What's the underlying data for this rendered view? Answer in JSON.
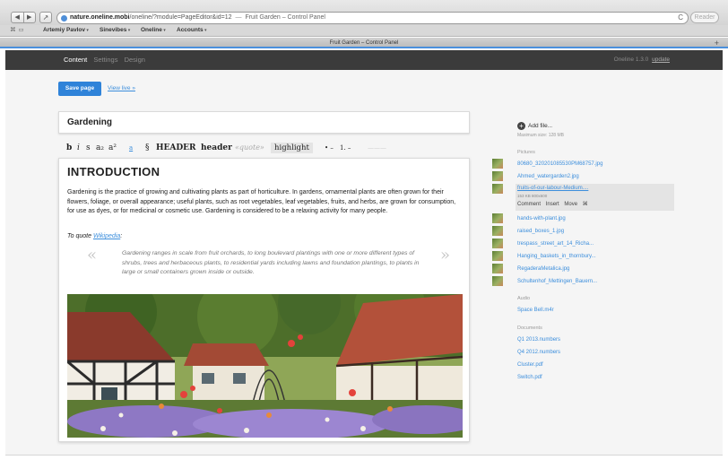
{
  "browser": {
    "nav_back": "◀",
    "nav_forward": "▶",
    "share": "↗",
    "url_host": "nature.oneline.mobi",
    "url_path": "/oneline/?module=PageEditor&id=12",
    "url_separator": "—",
    "url_page_title": "Fruit Garden – Control Panel",
    "reload": "C",
    "reader": "Reader",
    "bookmark_icons": "⌘▭",
    "bookmarks": [
      "Artemiy Pavlov",
      "Sinevibes",
      "Oneline",
      "Accounts"
    ],
    "tab_title": "Fruit Garden – Control Panel",
    "new_tab": "+"
  },
  "app": {
    "nav": {
      "content": "Content",
      "settings": "Settings",
      "design": "Design"
    },
    "version": "Oneline 1.3.0",
    "update": "update",
    "save_label": "Save page",
    "view_live": "View live »",
    "page_title": "Gardening"
  },
  "format_bar": {
    "bold": "b",
    "italic": "i",
    "strike": "s",
    "subscript": "a₂",
    "superscript": "a²",
    "link": "a",
    "section": "§",
    "header_big": "HEADER",
    "header_small": "header",
    "quote": "«quote»",
    "highlight": "highlight",
    "bullet_list": "• –",
    "numbered_list": "1. –",
    "divider": "———"
  },
  "editor": {
    "heading": "INTRODUCTION",
    "paragraph": "Gardening is the practice of growing and cultivating plants as part of horticulture. In gardens, ornamental plants are often grown for their flowers, foliage, or overall appearance; useful plants, such as root vegetables, leaf vegetables, fruits, and herbs, are grown for consumption, for use as dyes, or for medicinal or cosmetic use. Gardening is considered to be a relaxing activity for many people.",
    "quote_intro": "To quote ",
    "quote_link": "Wikipedia",
    "quote_colon": ":",
    "open_quote": "«",
    "close_quote": "»",
    "blockquote": "Gardening ranges in scale from fruit orchards, to long boulevard plantings with one or more different types of shrubs, trees and herbaceous plants, to residential yards including lawns and foundation plantings, to plants in large or small containers grown inside or outside."
  },
  "sidebar": {
    "add_file": "Add file...",
    "max_size": "Maximum size: 128 MB",
    "pictures_label": "Pictures",
    "pictures": [
      "80680_320201085530PM68757.jpg",
      "Ahmed_watergarden2.jpg",
      "fruits-of-our-labour-Medium....",
      "hands-with-plant.jpg",
      "raised_boxes_1.jpg",
      "trespass_street_art_14_Richa...",
      "Hanging_baskets_in_thornbury...",
      "RegaderaMetalica.jpg",
      "Schultenhof_Mettingen_Bauern..."
    ],
    "selected_meta": "153 KB   800x600",
    "selected_actions": {
      "comment": "Comment",
      "insert": "Insert",
      "move": "Move",
      "delete": "⌘"
    },
    "audio_label": "Audio",
    "audio": [
      "Space Bell.m4r"
    ],
    "documents_label": "Documents",
    "documents": [
      "Q1 2013.numbers",
      "Q4 2012.numbers",
      "Cluster.pdf",
      "Switch.pdf"
    ]
  },
  "colors": {
    "header_bg": "#3b3b3b",
    "accent": "#2f83d9",
    "link": "#3c8edc"
  }
}
